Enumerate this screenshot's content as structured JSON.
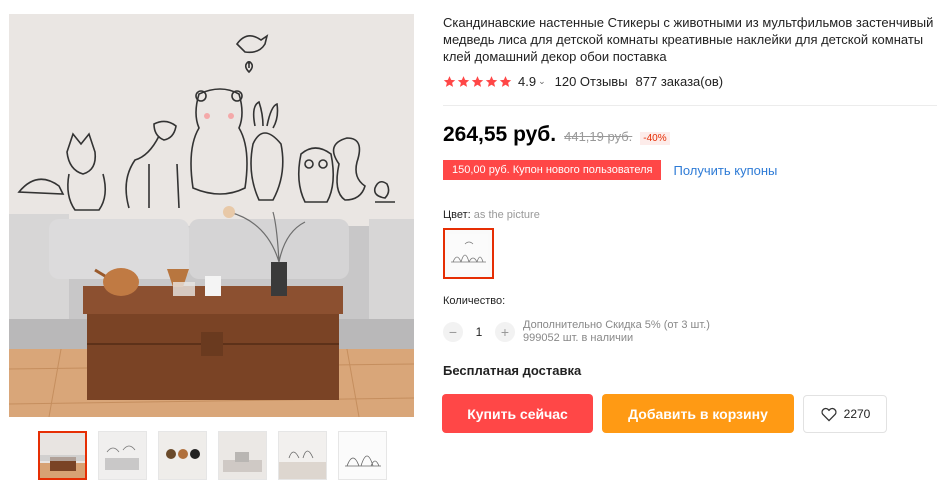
{
  "product": {
    "title": "Скандинавские настенные Стикеры с животными из мультфильмов застенчивый медведь лиса для детской комнаты креативные наклейки для детской комнаты клей домашний декор обои поставка",
    "rating": "4.9",
    "reviews": "120 Отзывы",
    "orders": "877 заказа(ов)",
    "stars": 5
  },
  "price": {
    "current": "264,55 руб.",
    "old": "441,19 руб.",
    "discount": "-40%"
  },
  "coupon": {
    "tag": "150,00 руб. Купон нового пользователя",
    "link": "Получить купоны"
  },
  "color": {
    "label": "Цвет:",
    "value": "as the picture"
  },
  "quantity": {
    "label": "Количество:",
    "value": "1",
    "discount_info": "Дополнительно Скидка 5% (от 3 шт.)",
    "stock": "999052 шт. в наличии"
  },
  "shipping": "Бесплатная доставка",
  "actions": {
    "buy": "Купить сейчас",
    "cart": "Добавить в корзину",
    "wishlist_count": "2270"
  },
  "colors": {
    "accent_red": "#ff4747",
    "accent_orange": "#ff9a14",
    "star": "#ff4747",
    "link_blue": "#2e7bd6"
  },
  "gallery": {
    "thumbnail_count": 6,
    "active_index": 0
  }
}
